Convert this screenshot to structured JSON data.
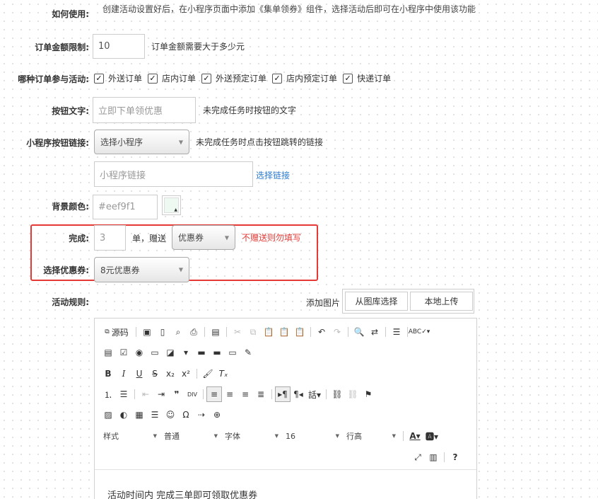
{
  "top_row": {
    "label": "如何使用:",
    "text": "创建活动设置好后，在小程序页面中添加《集单领券》组件，选择活动后即可在小程序中使用该功能"
  },
  "order_limit": {
    "label": "订单金额限制:",
    "value": "10",
    "hint": "订单金额需要大于多少元"
  },
  "order_types": {
    "label": "哪种订单参与活动:",
    "options": [
      "外送订单",
      "店内订单",
      "外送预定订单",
      "店内预定订单",
      "快递订单"
    ]
  },
  "button_text": {
    "label": "按钮文字:",
    "placeholder": "立即下单领优惠",
    "hint": "未完成任务时按钮的文字"
  },
  "mini_link": {
    "label": "小程序按钮链接:",
    "select": "选择小程序",
    "hint": "未完成任务时点击按钮跳转的链接",
    "link_placeholder": "小程序链接",
    "choose_link": "选择链接"
  },
  "bg_color": {
    "label": "背景颜色:",
    "placeholder": "#eef9f1",
    "swatch": "#eef9f1"
  },
  "complete": {
    "label": "完成:",
    "placeholder": "3",
    "unit": "单，赠送",
    "gift_select": "优惠券",
    "warning": "不赠送则勿填写"
  },
  "coupon": {
    "label": "选择优惠券:",
    "select": "8元优惠券"
  },
  "rules": {
    "label": "活动规则:",
    "add_image": "添加图片",
    "from_library": "从图库选择",
    "local_upload": "本地上传"
  },
  "editor": {
    "source_label": "源码",
    "combo_style": "样式",
    "combo_format": "普通",
    "combo_font": "字体",
    "combo_size": "16",
    "combo_lineheight": "行高",
    "content": "活动时间内 完成三单即可领取优惠券"
  },
  "colors": {
    "highlight_border": "#e53935",
    "warning": "#e53935",
    "link": "#2b7cd3"
  }
}
